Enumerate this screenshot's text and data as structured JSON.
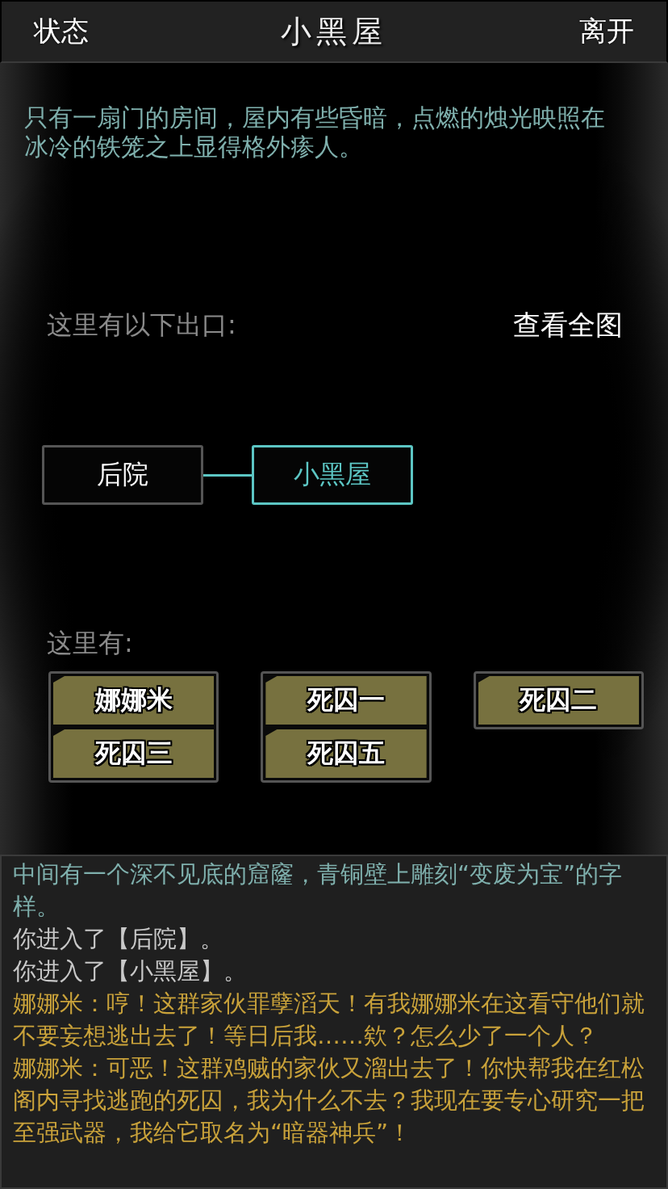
{
  "header": {
    "left_button": "状态",
    "title": "小黑屋",
    "right_button": "离开"
  },
  "description": "只有一扇门的房间，屋内有些昏暗，点燃的烛光映照在冰冷的铁笼之上显得格外瘆人。",
  "exits": {
    "label": "这里有以下出口:",
    "map_button": "查看全图",
    "rooms": [
      {
        "name": "后院",
        "selected": false
      },
      {
        "name": "小黑屋",
        "selected": true
      }
    ]
  },
  "present": {
    "label": "这里有:",
    "stacks": [
      {
        "items": [
          "娜娜米",
          "死囚三"
        ]
      },
      {
        "items": [
          "死囚一",
          "死囚五"
        ]
      },
      {
        "items": [
          "死囚二"
        ]
      }
    ]
  },
  "log": [
    {
      "kind": "narration",
      "text": "中间有一个深不见底的窟窿，青铜壁上雕刻“变废为宝”的字样。"
    },
    {
      "kind": "system",
      "text": "你进入了【后院】。"
    },
    {
      "kind": "system",
      "text": "你进入了【小黑屋】。"
    },
    {
      "kind": "speech",
      "text": "娜娜米：哼！这群家伙罪孽滔天！有我娜娜米在这看守他们就不要妄想逃出去了！等日后我……欸？怎么少了一个人？"
    },
    {
      "kind": "speech",
      "text": "娜娜米：可恶！这群鸡贼的家伙又溜出去了！你快帮我在红松阁内寻找逃跑的死囚，我为什么不去？我现在要专心研究一把至强武器，我给它取名为“暗器神兵”！"
    }
  ]
}
